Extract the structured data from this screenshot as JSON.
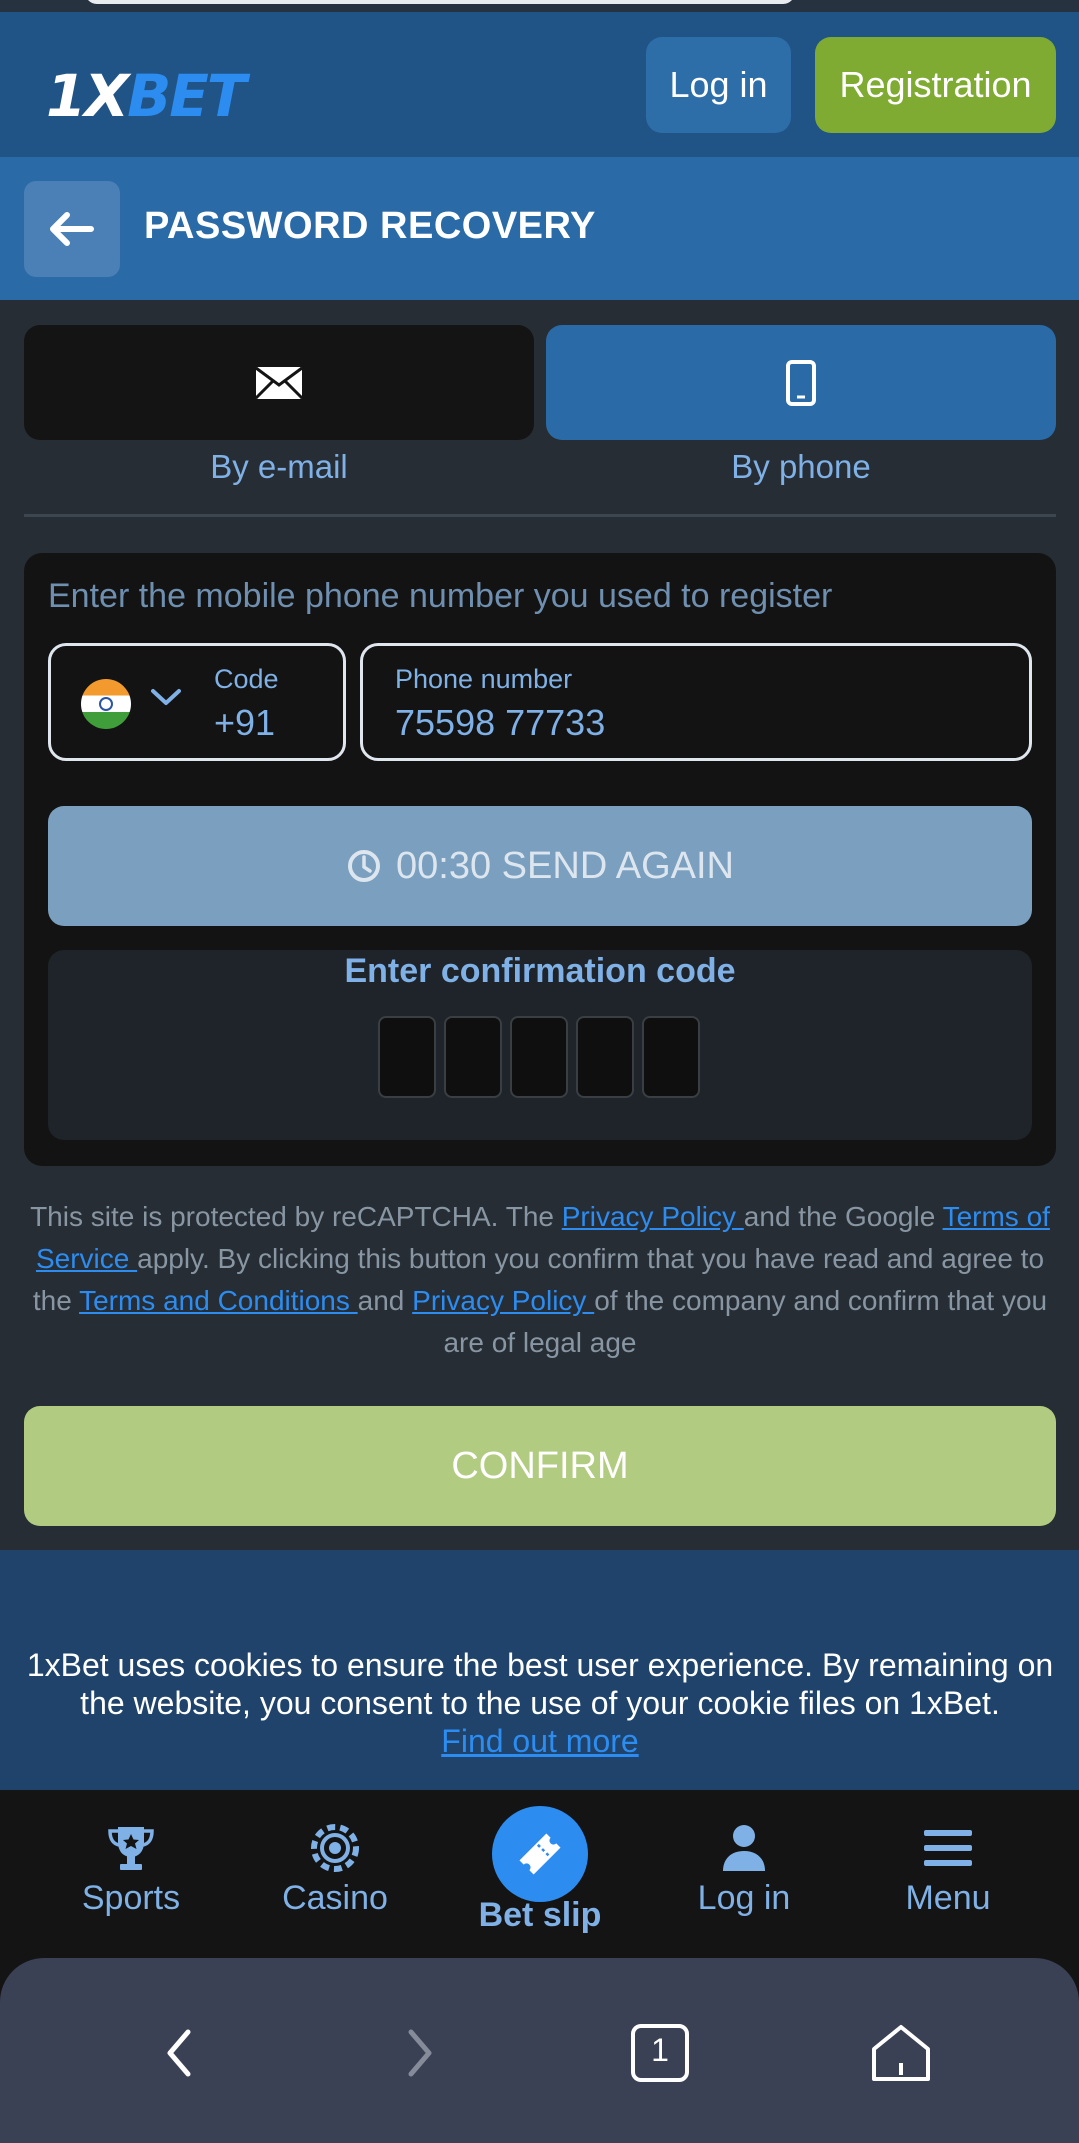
{
  "header": {
    "logo_one": "1X",
    "logo_rest": "BET",
    "login_label": "Log in",
    "register_label": "Registration"
  },
  "page": {
    "title": "PASSWORD RECOVERY"
  },
  "tabs": [
    {
      "label": "By e-mail",
      "icon": "envelope-icon",
      "active": false
    },
    {
      "label": "By phone",
      "icon": "phone-icon",
      "active": true
    }
  ],
  "form": {
    "hint": "Enter the mobile phone number you used to register",
    "code_label": "Code",
    "code_value": "+91",
    "country_flag": "india-flag",
    "phone_label": "Phone number",
    "phone_value": "75598 77733",
    "send_again_label": "00:30 SEND AGAIN",
    "confirmation_title": "Enter confirmation code",
    "digit_count": 5
  },
  "legal": {
    "t1": "This site is protected by reCAPTCHA. The ",
    "link1": "Privacy Policy ",
    "t2": "and the Google ",
    "link2": "Terms of Service ",
    "t3": "apply.  By clicking this button you confirm that you have read and agree to the ",
    "link3": "Terms and Conditions ",
    "t4": "and ",
    "link4": "Privacy Policy ",
    "t5": "of the company and confirm that you are of legal age"
  },
  "confirm_label": "CONFIRM",
  "cookie": {
    "text": "1xBet uses cookies to ensure the best user experience. By remaining on the website, you consent to the use of your cookie files on 1xBet.",
    "link": "Find out more"
  },
  "bottom_nav": [
    {
      "label": "Sports",
      "icon": "trophy-icon"
    },
    {
      "label": "Casino",
      "icon": "casino-chip-icon"
    },
    {
      "label": "Bet slip",
      "icon": "ticket-icon"
    },
    {
      "label": "Log in",
      "icon": "user-icon"
    },
    {
      "label": "Menu",
      "icon": "menu-icon"
    }
  ],
  "browser": {
    "tab_count": "1"
  },
  "colors": {
    "brand_blue": "#2a6aa6",
    "accent_green": "#7fab32",
    "link_blue": "#2c8cf0"
  }
}
